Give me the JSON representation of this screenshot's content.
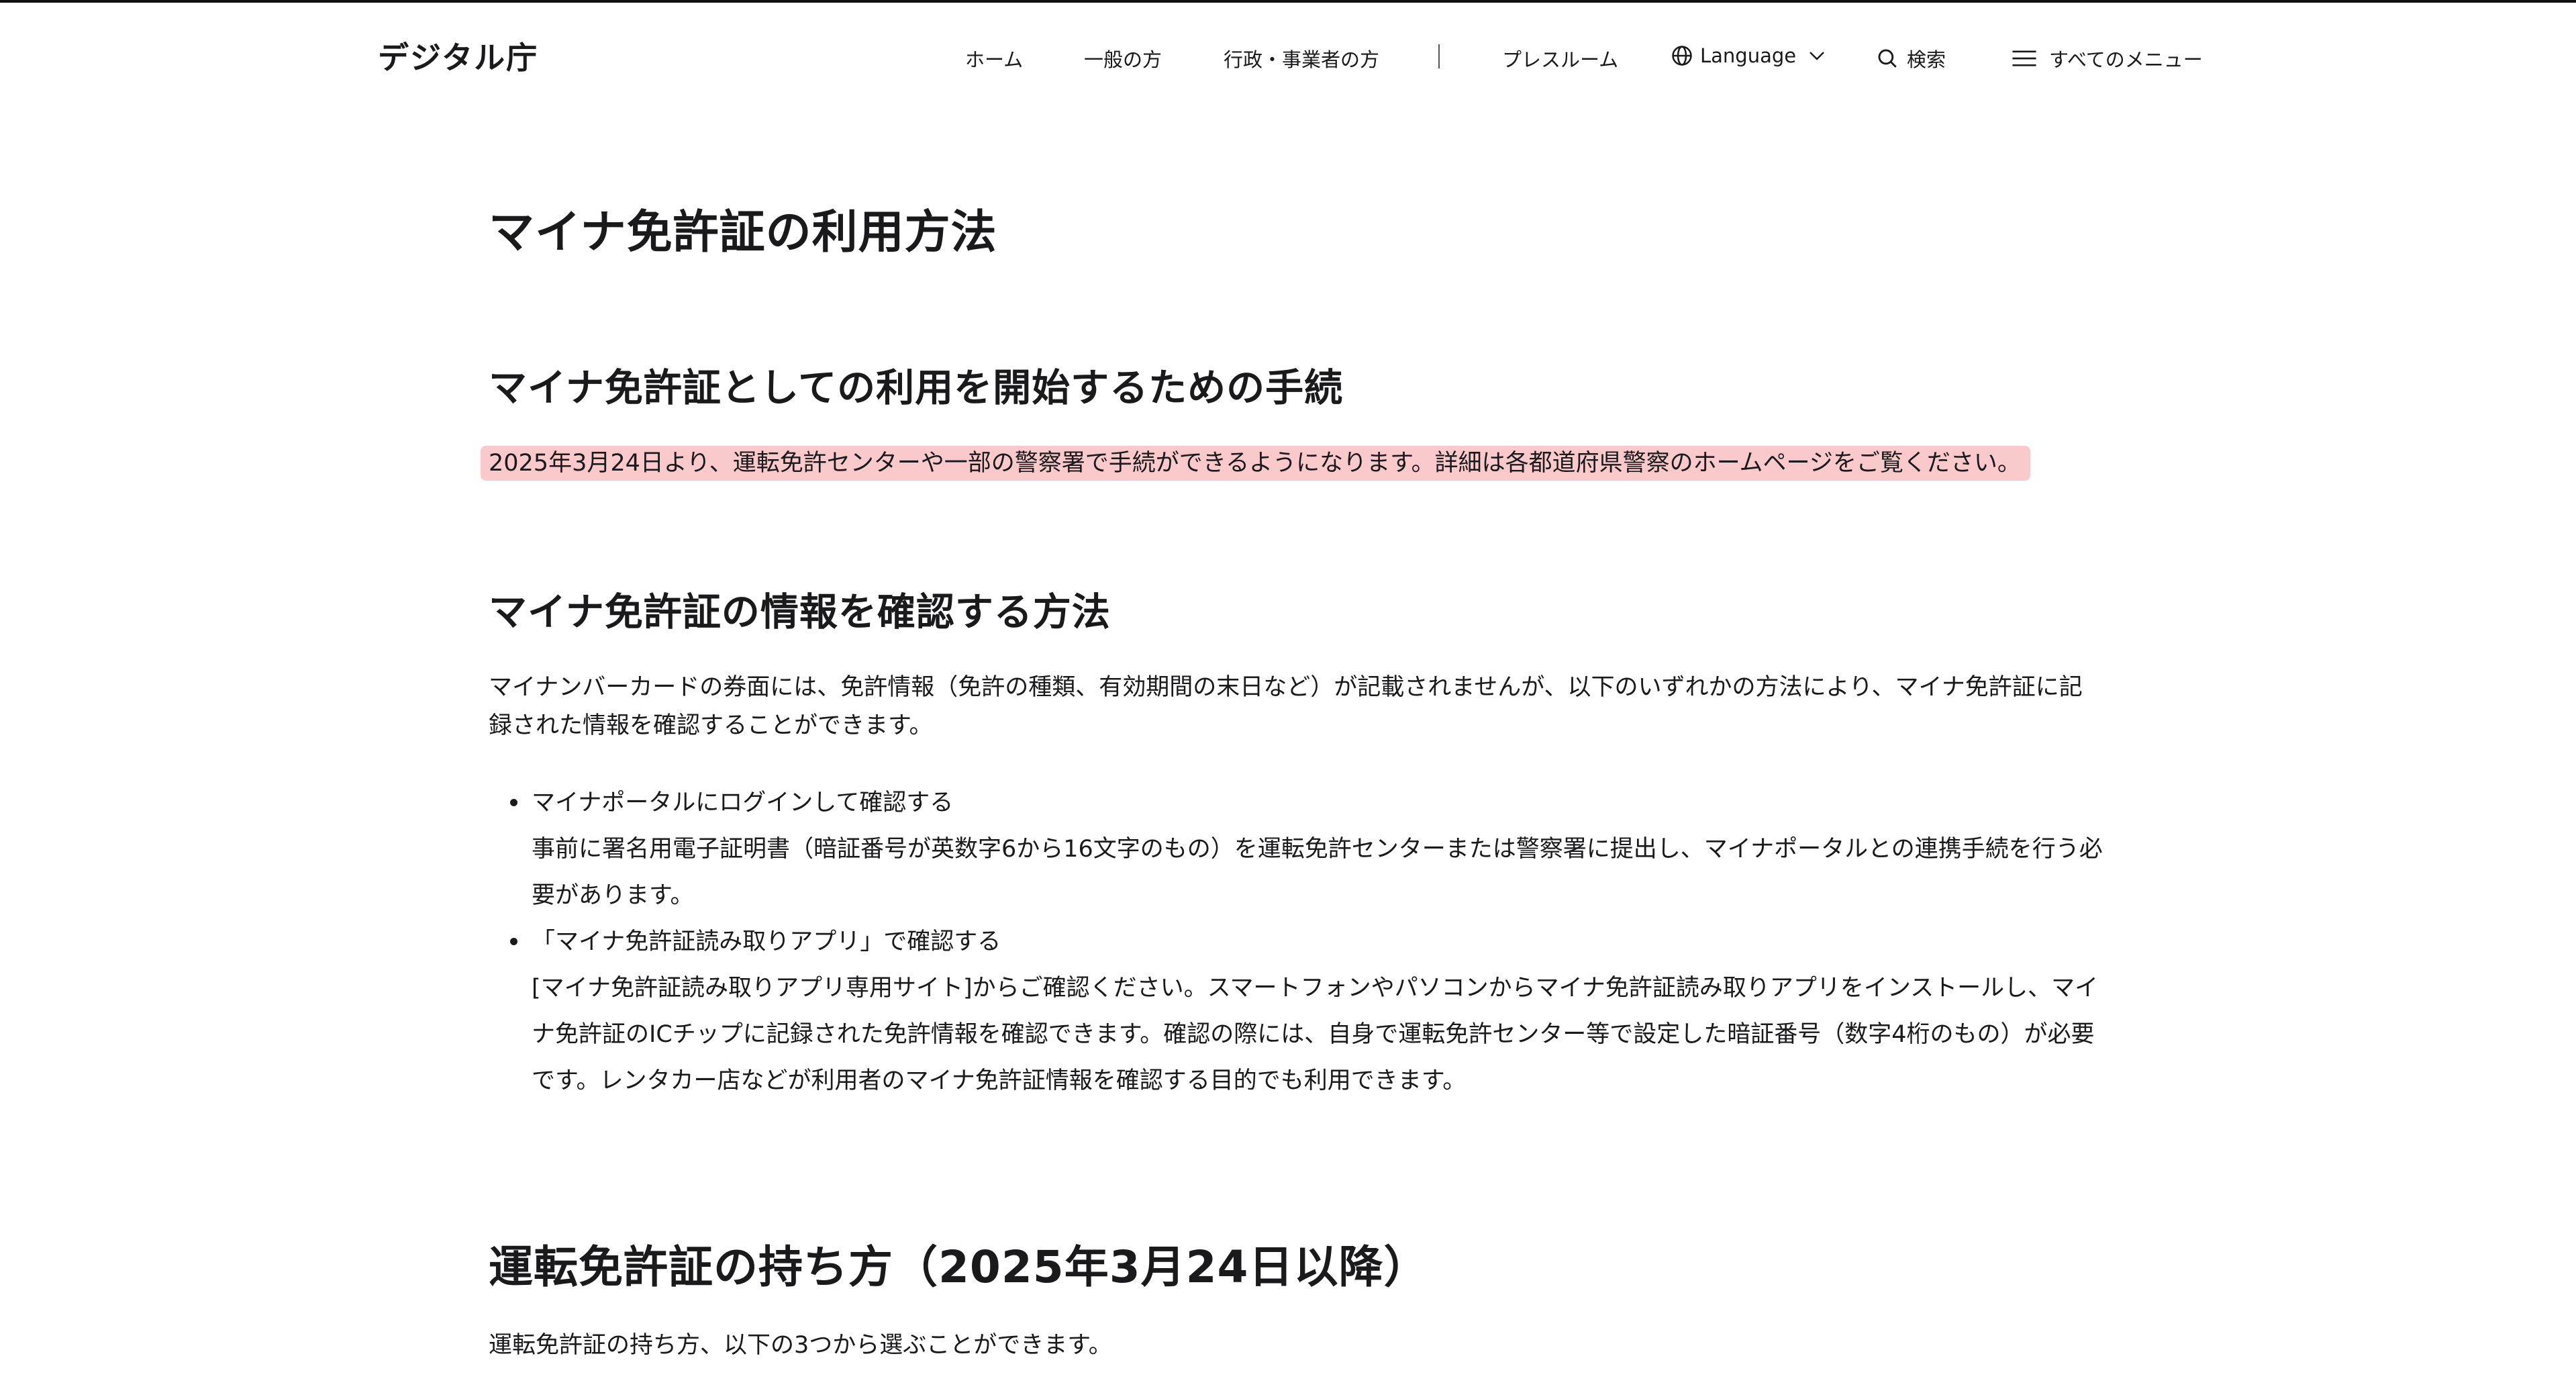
{
  "header": {
    "logo": "デジタル庁",
    "nav": {
      "home": "ホーム",
      "general": "一般の方",
      "business": "行政・事業者の方",
      "press": "プレスルーム",
      "language": "Language",
      "search": "検索",
      "menu": "すべてのメニュー"
    }
  },
  "main": {
    "title": "マイナ免許証の利用方法",
    "section1": {
      "heading": "マイナ免許証としての利用を開始するための手続",
      "notice": "2025年3月24日より、運転免許センターや一部の警察署で手続ができるようになります。詳細は各都道府県警察のホームページをご覧ください。"
    },
    "section2": {
      "heading": "マイナ免許証の情報を確認する方法",
      "intro_line1": "マイナンバーカードの券面には、免許情報（免許の種類、有効期間の末日など）が記載されませんが、以下のいずれかの方法により、マイナ免許証に記",
      "intro_line2": "録された情報を確認することができます。",
      "items": [
        {
          "title": "マイナポータルにログインして確認する",
          "line1": "事前に署名用電子証明書（暗証番号が英数字6から16文字のもの）を運転免許センターまたは警察署に提出し、マイナポータルとの連携手続を行う必",
          "line2": "要があります。"
        },
        {
          "title": "「マイナ免許証読み取りアプリ」で確認する",
          "line1": "[マイナ免許証読み取りアプリ専用サイト]からご確認ください。スマートフォンやパソコンからマイナ免許証読み取りアプリをインストールし、マイ",
          "line2": "ナ免許証のICチップに記録された免許情報を確認できます。確認の際には、自身で運転免許センター等で設定した暗証番号（数字4桁のもの）が必要",
          "line3": "です。レンタカー店などが利用者のマイナ免許証情報を確認する目的でも利用できます。"
        }
      ]
    },
    "section3": {
      "heading": "運転免許証の持ち方（2025年3月24日以降）",
      "intro": "運転免許証の持ち方、以下の3つから選ぶことができます。"
    }
  },
  "icons": {
    "language": "globe-icon",
    "language_dropdown": "chevron-down-icon",
    "search": "search-icon",
    "menu": "hamburger-menu-icon"
  },
  "colors": {
    "highlight": "#f9c9cc",
    "text": "#1a1a1c"
  }
}
